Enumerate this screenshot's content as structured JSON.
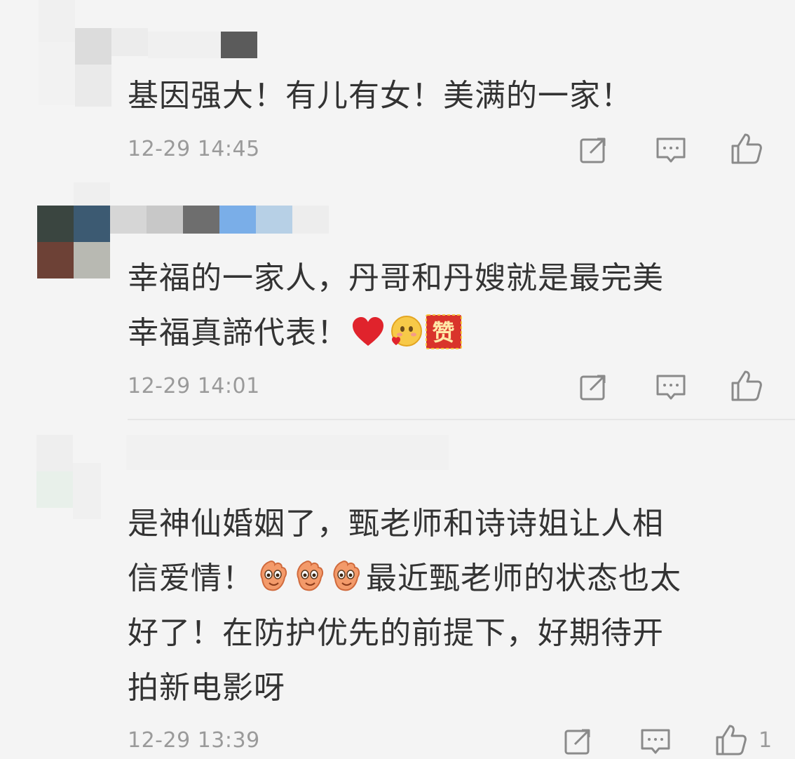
{
  "comments": [
    {
      "text": "基因强大！有儿有女！美满的一家！",
      "time": "12-29 14:45",
      "actions": [
        "share-icon",
        "comment-icon",
        "like-icon"
      ]
    },
    {
      "text_line1": "幸福的一家人，丹哥和丹嫂就是最完美",
      "text_line2": "幸福真諦代表！",
      "emojis": [
        "heart-emoji",
        "love-face-emoji",
        "zan-emoji"
      ],
      "zan_label": "赞",
      "time": "12-29 14:01",
      "actions": [
        "share-icon",
        "comment-icon",
        "like-icon"
      ]
    },
    {
      "text_line1": "是神仙婚姻了，甄老师和诗诗姐让人相",
      "text_line2_a": "信爱情！",
      "text_line2_b": "最近甄老师的状态也太",
      "text_line3": "好了！在防护优先的前提下，好期待开",
      "text_line4": "拍新电影呀",
      "emojis": [
        "clap-emoji",
        "clap-emoji",
        "clap-emoji"
      ],
      "time": "12-29 13:39",
      "like_count": "1",
      "actions": [
        "share-icon",
        "comment-icon",
        "like-icon"
      ]
    }
  ],
  "colors": {
    "background": "#f4f4f4",
    "text": "#333333",
    "meta": "#9a9a9a",
    "icon": "#8a8a8a",
    "heart": "#e0232c",
    "zan_bg": "#d9342b"
  }
}
